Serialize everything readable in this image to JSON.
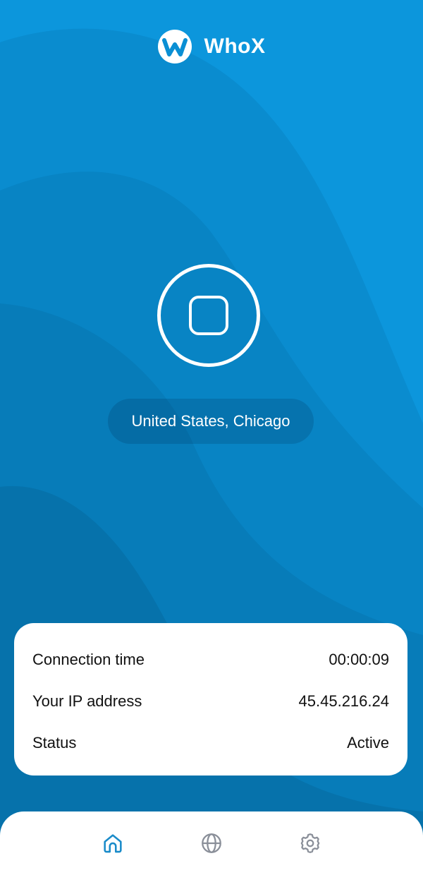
{
  "app": {
    "title": "WhoX",
    "logo": "whox-logo"
  },
  "connection": {
    "button_state": "connected",
    "button_icon": "stop-icon",
    "location": "United States, Chicago"
  },
  "info": {
    "rows": [
      {
        "label": "Connection time",
        "value": "00:00:09"
      },
      {
        "label": "Your IP address",
        "value": "45.45.216.24"
      },
      {
        "label": "Status",
        "value": "Active"
      }
    ]
  },
  "nav": {
    "items": [
      {
        "name": "home",
        "icon": "home-icon",
        "active": true
      },
      {
        "name": "servers",
        "icon": "globe-icon",
        "active": false
      },
      {
        "name": "settings",
        "icon": "gear-icon",
        "active": false
      }
    ]
  },
  "colors": {
    "background": "#0a8fd4",
    "accent_active": "#1a8bc9",
    "inactive_icon": "#8a8f99",
    "card": "#ffffff"
  }
}
